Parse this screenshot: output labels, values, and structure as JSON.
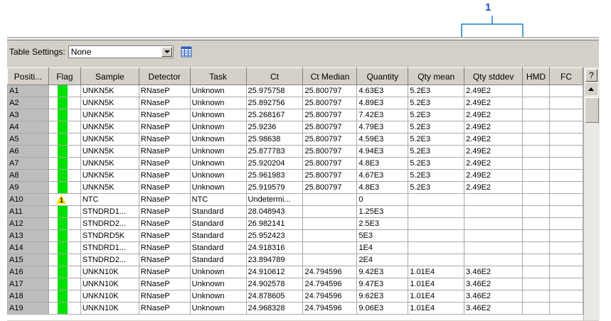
{
  "callout": {
    "number": "1"
  },
  "settings": {
    "label": "Table Settings:",
    "selected": "None"
  },
  "columns": [
    "Positi...",
    "Flag",
    "Sample",
    "Detector",
    "Task",
    "Ct",
    "Ct Median",
    "Quantity",
    "Qty mean",
    "Qty stddev",
    "HMD",
    "FC"
  ],
  "help_glyph": "?",
  "flag_colors": {
    "ok": "#00e000",
    "warning": "#f5e400"
  },
  "rows": [
    {
      "pos": "A1",
      "flag": "ok",
      "sample": "UNKN5K",
      "detector": "RNaseP",
      "task": "Unknown",
      "ct": "25.975758",
      "ctmed": "25.800797",
      "qty": "4.63E3",
      "qmean": "5.2E3",
      "qstd": "2.49E2"
    },
    {
      "pos": "A2",
      "flag": "ok",
      "sample": "UNKN5K",
      "detector": "RNaseP",
      "task": "Unknown",
      "ct": "25.892756",
      "ctmed": "25.800797",
      "qty": "4.89E3",
      "qmean": "5.2E3",
      "qstd": "2.49E2"
    },
    {
      "pos": "A3",
      "flag": "ok",
      "sample": "UNKN5K",
      "detector": "RNaseP",
      "task": "Unknown",
      "ct": "25.268167",
      "ctmed": "25.800797",
      "qty": "7.42E3",
      "qmean": "5.2E3",
      "qstd": "2.49E2"
    },
    {
      "pos": "A4",
      "flag": "ok",
      "sample": "UNKN5K",
      "detector": "RNaseP",
      "task": "Unknown",
      "ct": "25.9236",
      "ctmed": "25.800797",
      "qty": "4.79E3",
      "qmean": "5.2E3",
      "qstd": "2.49E2"
    },
    {
      "pos": "A5",
      "flag": "ok",
      "sample": "UNKN5K",
      "detector": "RNaseP",
      "task": "Unknown",
      "ct": "25.98638",
      "ctmed": "25.800797",
      "qty": "4.59E3",
      "qmean": "5.2E3",
      "qstd": "2.49E2"
    },
    {
      "pos": "A6",
      "flag": "ok",
      "sample": "UNKN5K",
      "detector": "RNaseP",
      "task": "Unknown",
      "ct": "25.877783",
      "ctmed": "25.800797",
      "qty": "4.94E3",
      "qmean": "5.2E3",
      "qstd": "2.49E2"
    },
    {
      "pos": "A7",
      "flag": "ok",
      "sample": "UNKN5K",
      "detector": "RNaseP",
      "task": "Unknown",
      "ct": "25.920204",
      "ctmed": "25.800797",
      "qty": "4.8E3",
      "qmean": "5.2E3",
      "qstd": "2.49E2"
    },
    {
      "pos": "A8",
      "flag": "ok",
      "sample": "UNKN5K",
      "detector": "RNaseP",
      "task": "Unknown",
      "ct": "25.961983",
      "ctmed": "25.800797",
      "qty": "4.67E3",
      "qmean": "5.2E3",
      "qstd": "2.49E2"
    },
    {
      "pos": "A9",
      "flag": "ok",
      "sample": "UNKN5K",
      "detector": "RNaseP",
      "task": "Unknown",
      "ct": "25.919579",
      "ctmed": "25.800797",
      "qty": "4.8E3",
      "qmean": "5.2E3",
      "qstd": "2.49E2"
    },
    {
      "pos": "A10",
      "flag": "warn",
      "flag_num": "1",
      "sample": "NTC",
      "detector": "RNaseP",
      "task": "NTC",
      "ct": "Undetermi...",
      "ctmed": "",
      "qty": "0",
      "qmean": "",
      "qstd": ""
    },
    {
      "pos": "A11",
      "flag": "ok",
      "sample": "STNDRD1...",
      "detector": "RNaseP",
      "task": "Standard",
      "ct": "28.048943",
      "ctmed": "",
      "qty": "1.25E3",
      "qmean": "",
      "qstd": ""
    },
    {
      "pos": "A12",
      "flag": "ok",
      "sample": "STNDRD2...",
      "detector": "RNaseP",
      "task": "Standard",
      "ct": "26.982141",
      "ctmed": "",
      "qty": "2.5E3",
      "qmean": "",
      "qstd": ""
    },
    {
      "pos": "A13",
      "flag": "ok",
      "sample": "STNDRD5K",
      "detector": "RNaseP",
      "task": "Standard",
      "ct": "25.952423",
      "ctmed": "",
      "qty": "5E3",
      "qmean": "",
      "qstd": ""
    },
    {
      "pos": "A14",
      "flag": "ok",
      "sample": "STNDRD1...",
      "detector": "RNaseP",
      "task": "Standard",
      "ct": "24.918316",
      "ctmed": "",
      "qty": "1E4",
      "qmean": "",
      "qstd": ""
    },
    {
      "pos": "A15",
      "flag": "ok",
      "sample": "STNDRD2...",
      "detector": "RNaseP",
      "task": "Standard",
      "ct": "23.894789",
      "ctmed": "",
      "qty": "2E4",
      "qmean": "",
      "qstd": ""
    },
    {
      "pos": "A16",
      "flag": "ok",
      "sample": "UNKN10K",
      "detector": "RNaseP",
      "task": "Unknown",
      "ct": "24.910612",
      "ctmed": "24.794596",
      "qty": "9.42E3",
      "qmean": "1.01E4",
      "qstd": "3.46E2"
    },
    {
      "pos": "A17",
      "flag": "ok",
      "sample": "UNKN10K",
      "detector": "RNaseP",
      "task": "Unknown",
      "ct": "24.902578",
      "ctmed": "24.794596",
      "qty": "9.47E3",
      "qmean": "1.01E4",
      "qstd": "3.46E2"
    },
    {
      "pos": "A18",
      "flag": "ok",
      "sample": "UNKN10K",
      "detector": "RNaseP",
      "task": "Unknown",
      "ct": "24.878605",
      "ctmed": "24.794596",
      "qty": "9.62E3",
      "qmean": "1.01E4",
      "qstd": "3.46E2"
    },
    {
      "pos": "A19",
      "flag": "ok",
      "sample": "UNKN10K",
      "detector": "RNaseP",
      "task": "Unknown",
      "ct": "24.968328",
      "ctmed": "24.794596",
      "qty": "9.06E3",
      "qmean": "1.01E4",
      "qstd": "3.46E2"
    }
  ]
}
